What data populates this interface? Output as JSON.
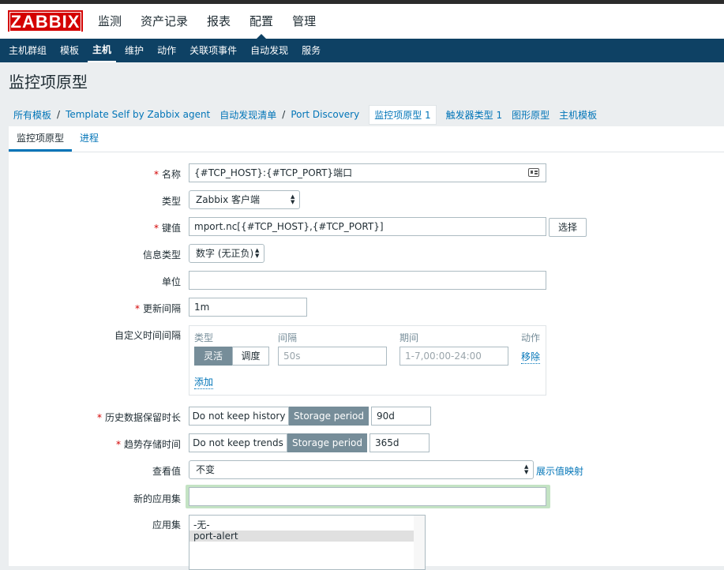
{
  "app": {
    "logo": "ZABBIX"
  },
  "topmenu": [
    "监测",
    "资产记录",
    "报表",
    "配置",
    "管理"
  ],
  "submenu": [
    "主机群组",
    "模板",
    "主机",
    "维护",
    "动作",
    "关联项事件",
    "自动发现",
    "服务"
  ],
  "page": {
    "title": "监控项原型"
  },
  "breadcrumbs": {
    "all_templates": "所有模板",
    "template": "Template Self by Zabbix agent",
    "discovery_list": "自动发现清单",
    "discovery_rule": "Port Discovery",
    "item_prototypes": "监控项原型 1",
    "trigger_prototypes": "触发器类型 1",
    "graph_prototypes": "图形原型",
    "host_prototypes": "主机模板"
  },
  "tabs": {
    "item_prototype": "监控项原型",
    "process": "进程"
  },
  "form": {
    "name": {
      "label": "名称",
      "value": "{#TCP_HOST}:{#TCP_PORT}端口"
    },
    "type": {
      "label": "类型",
      "value": "Zabbix 客户端"
    },
    "key": {
      "label": "键值",
      "value": "mport.nc[{#TCP_HOST},{#TCP_PORT}]",
      "select_label": "选择"
    },
    "info_type": {
      "label": "信息类型",
      "value": "数字 (无正负)"
    },
    "units": {
      "label": "单位",
      "value": ""
    },
    "update_interval": {
      "label": "更新间隔",
      "value": "1m"
    },
    "custom_intervals": {
      "label": "自定义时间间隔",
      "col_type": "类型",
      "col_interval": "间隔",
      "col_period": "期间",
      "col_action": "动作",
      "flexible": "灵活",
      "scheduling": "调度",
      "interval_placeholder": "50s",
      "period_placeholder": "1-7,00:00-24:00",
      "remove": "移除",
      "add": "添加"
    },
    "history": {
      "label": "历史数据保留时长",
      "no_keep": "Do not keep history",
      "storage": "Storage period",
      "value": "90d"
    },
    "trends": {
      "label": "趋势存储时间",
      "no_keep": "Do not keep trends",
      "storage": "Storage period",
      "value": "365d"
    },
    "valuemap": {
      "label": "查看值",
      "value": "不变",
      "link": "展示值映射"
    },
    "new_app": {
      "label": "新的应用集",
      "value": ""
    },
    "apps": {
      "label": "应用集",
      "items": [
        "-无-",
        "port-alert"
      ]
    }
  },
  "colors": {
    "brand": "#d40000",
    "nav": "#0e4164",
    "link": "#0275b8",
    "segment_on": "#768d99"
  }
}
